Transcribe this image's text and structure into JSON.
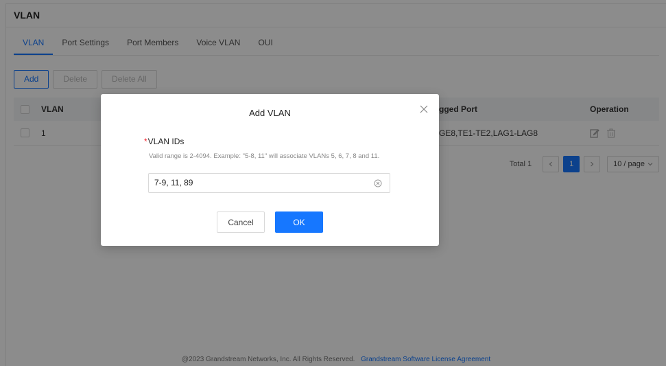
{
  "page": {
    "title": "VLAN",
    "tabs": [
      {
        "label": "VLAN",
        "active": true
      },
      {
        "label": "Port Settings",
        "active": false
      },
      {
        "label": "Port Members",
        "active": false
      },
      {
        "label": "Voice VLAN",
        "active": false
      },
      {
        "label": "OUI",
        "active": false
      }
    ]
  },
  "toolbar": {
    "add_label": "Add",
    "delete_label": "Delete",
    "delete_all_label": "Delete All"
  },
  "table": {
    "columns": {
      "vlan": "VLAN",
      "tagged_port": "gged Port",
      "operation": "Operation"
    },
    "rows": [
      {
        "vlan": "1",
        "tagged_port": "GE8,TE1-TE2,LAG1-LAG8"
      }
    ]
  },
  "pagination": {
    "total_label": "Total 1",
    "current_page": "1",
    "page_size": "10 / page"
  },
  "footer": {
    "copyright": "@2023 Grandstream Networks, Inc. All Rights Reserved.",
    "license_link": "Grandstream Software License Agreement"
  },
  "modal": {
    "title": "Add VLAN",
    "field_label": "VLAN IDs",
    "required_mark": "*",
    "hint": "Valid range is 2-4094. Example: \"5-8, 11\" will associate VLANs 5, 6, 7, 8 and 11.",
    "input_value": "7-9, 11, 89",
    "cancel_label": "Cancel",
    "ok_label": "OK"
  },
  "colors": {
    "accent": "#1677ff",
    "required": "#f5222d",
    "overlay": "rgba(0,0,0,0.45)"
  },
  "icons": [
    "close-icon",
    "clear-input-icon",
    "edit-icon",
    "delete-icon",
    "chevron-left-icon",
    "chevron-right-icon",
    "chevron-down-icon"
  ]
}
